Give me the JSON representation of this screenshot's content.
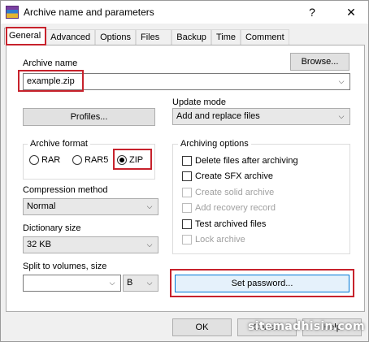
{
  "window": {
    "title": "Archive name and parameters",
    "help_label": "?",
    "close_label": "✕"
  },
  "tabs": [
    "General",
    "Advanced",
    "Options",
    "Files",
    "Backup",
    "Time",
    "Comment"
  ],
  "general": {
    "archive_name_label": "Archive name",
    "archive_name_value": "example.zip",
    "browse_label": "Browse...",
    "profiles_label": "Profiles...",
    "update_mode_label": "Update mode",
    "update_mode_value": "Add and replace files",
    "archive_format_label": "Archive format",
    "formats": [
      "RAR",
      "RAR5",
      "ZIP"
    ],
    "selected_format": "ZIP",
    "compression_method_label": "Compression method",
    "compression_method_value": "Normal",
    "dictionary_size_label": "Dictionary size",
    "dictionary_size_value": "32 KB",
    "split_label": "Split to volumes, size",
    "split_value": "",
    "split_unit": "B",
    "archiving_options_label": "Archiving options",
    "options": [
      {
        "label": "Delete files after archiving",
        "checked": false,
        "enabled": true
      },
      {
        "label": "Create SFX archive",
        "checked": false,
        "enabled": true
      },
      {
        "label": "Create solid archive",
        "checked": false,
        "enabled": false
      },
      {
        "label": "Add recovery record",
        "checked": false,
        "enabled": false
      },
      {
        "label": "Test archived files",
        "checked": false,
        "enabled": true
      },
      {
        "label": "Lock archive",
        "checked": false,
        "enabled": false
      }
    ],
    "set_password_label": "Set password..."
  },
  "footer": {
    "ok_label": "OK",
    "cancel_label": "Cancel",
    "help_label": "Help"
  },
  "watermark": "sitemadhisin.com",
  "colors": {
    "highlight": "#c7222c",
    "focus_border": "#0078d7",
    "panel_bg": "#ffffff",
    "window_bg": "#f0f0f0"
  }
}
